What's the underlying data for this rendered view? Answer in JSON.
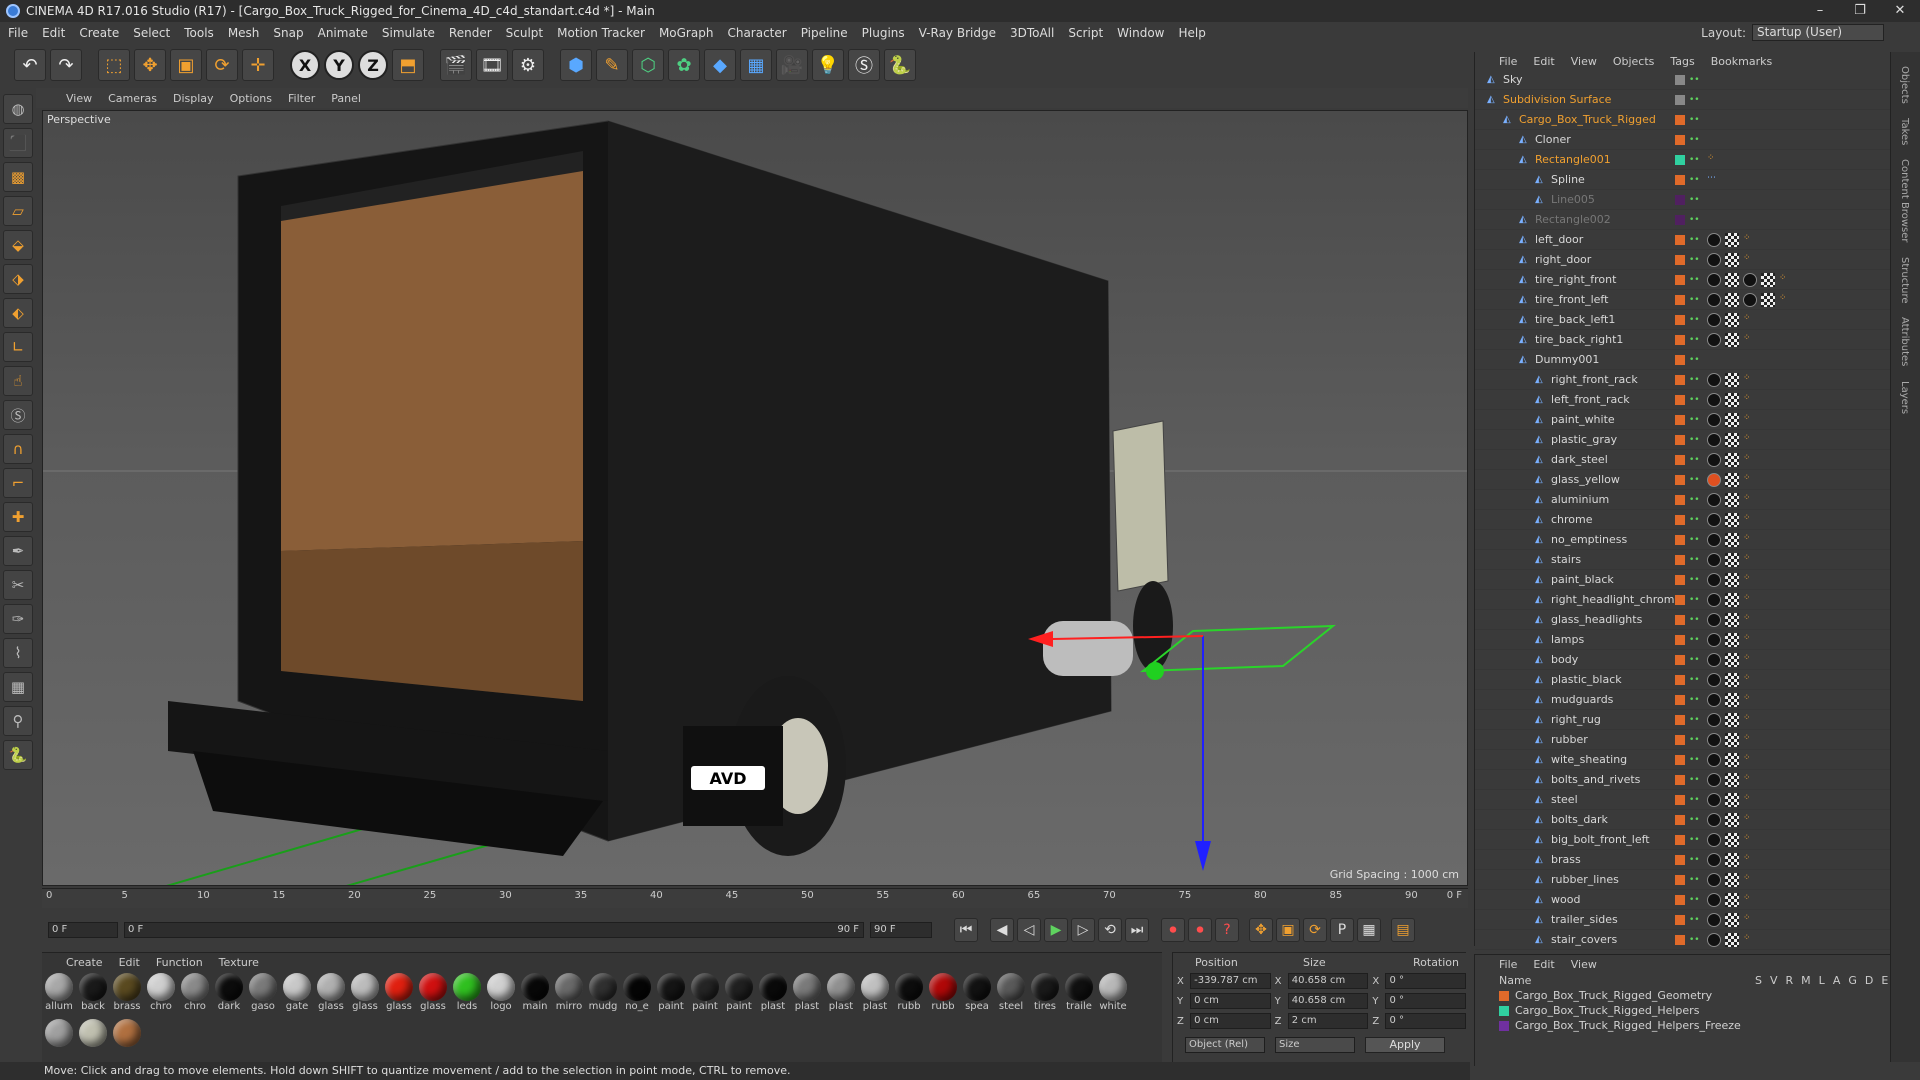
{
  "window": {
    "title": "CINEMA 4D R17.016 Studio (R17) - [Cargo_Box_Truck_Rigged_for_Cinema_4D_c4d_standart.c4d *] - Main"
  },
  "menu": [
    "File",
    "Edit",
    "Create",
    "Select",
    "Tools",
    "Mesh",
    "Snap",
    "Animate",
    "Simulate",
    "Render",
    "Sculpt",
    "Motion Tracker",
    "MoGraph",
    "Character",
    "Pipeline",
    "Plugins",
    "V-Ray Bridge",
    "3DToAll",
    "Script",
    "Window",
    "Help"
  ],
  "layout": {
    "label": "Layout:",
    "value": "Startup (User)"
  },
  "viewport": {
    "menu": [
      "View",
      "Cameras",
      "Display",
      "Options",
      "Filter",
      "Panel"
    ],
    "label": "Perspective",
    "grid_spacing": "Grid Spacing : 1000 cm",
    "plate": "AVD"
  },
  "timeline": {
    "ticks": [
      "0",
      "5",
      "10",
      "15",
      "20",
      "25",
      "30",
      "35",
      "40",
      "45",
      "50",
      "55",
      "60",
      "65",
      "70",
      "75",
      "80",
      "85",
      "90"
    ],
    "frame_end_label": "0 F",
    "start_field": "0 F",
    "slider_start": "0 F",
    "slider_end": "90 F",
    "end_field": "90 F"
  },
  "materials": {
    "menu": [
      "Create",
      "Edit",
      "Function",
      "Texture"
    ],
    "items": [
      {
        "n": "allum",
        "c": "#a8a8a8"
      },
      {
        "n": "back",
        "c": "#1a1a1a"
      },
      {
        "n": "brass",
        "c": "#5a4a20"
      },
      {
        "n": "chro",
        "c": "#cfcfcf"
      },
      {
        "n": "chro",
        "c": "#8a8a8a"
      },
      {
        "n": "dark",
        "c": "#0c0c0c"
      },
      {
        "n": "gaso",
        "c": "#7a7a7a"
      },
      {
        "n": "gate",
        "c": "#c8c8c8"
      },
      {
        "n": "glass",
        "c": "#b0b0b0"
      },
      {
        "n": "glass",
        "c": "#bcbcbc"
      },
      {
        "n": "glass",
        "c": "#e02010"
      },
      {
        "n": "glass",
        "c": "#d01010"
      },
      {
        "n": "leds",
        "c": "#30c020"
      },
      {
        "n": "logo",
        "c": "#d0d0d0"
      },
      {
        "n": "main",
        "c": "#080808"
      },
      {
        "n": "mirro",
        "c": "#6a6a6a"
      },
      {
        "n": "mudg",
        "c": "#303030"
      },
      {
        "n": "no_e",
        "c": "#050505"
      },
      {
        "n": "paint",
        "c": "#151515"
      },
      {
        "n": "paint",
        "c": "#252525"
      },
      {
        "n": "paint",
        "c": "#202020"
      },
      {
        "n": "plast",
        "c": "#0a0a0a"
      },
      {
        "n": "plast",
        "c": "#7a7a7a"
      },
      {
        "n": "plast",
        "c": "#909090"
      },
      {
        "n": "plast",
        "c": "#c0c0c0"
      },
      {
        "n": "rubb",
        "c": "#0d0d0d"
      },
      {
        "n": "rubb",
        "c": "#b00808"
      },
      {
        "n": "spea",
        "c": "#121212"
      },
      {
        "n": "steel",
        "c": "#5a5a5a"
      },
      {
        "n": "tires",
        "c": "#1a1a1a"
      },
      {
        "n": "traile",
        "c": "#101010"
      },
      {
        "n": "white",
        "c": "#b8b8b8"
      },
      {
        "n": "",
        "c": "#a0a0a0"
      },
      {
        "n": "",
        "c": "#c0c0b0"
      },
      {
        "n": "",
        "c": "#b07040"
      }
    ]
  },
  "coords": {
    "headers": [
      "Position",
      "Size",
      "Rotation"
    ],
    "rows": [
      {
        "a": "X",
        "pos": "-339.787 cm",
        "b": "X",
        "size": "40.658 cm",
        "c": "X",
        "rot": "0 °"
      },
      {
        "a": "Y",
        "pos": "0 cm",
        "b": "Y",
        "size": "40.658 cm",
        "c": "Y",
        "rot": "0 °"
      },
      {
        "a": "Z",
        "pos": "0 cm",
        "b": "Z",
        "size": "2 cm",
        "c": "Z",
        "rot": "0 °"
      }
    ],
    "mode": "Object (Rel)",
    "sizemode": "Size",
    "apply": "Apply"
  },
  "status": "Move: Click and drag to move elements. Hold down SHIFT to quantize movement / add to the selection in point mode, CTRL to remove.",
  "objects": {
    "menu": [
      "File",
      "Edit",
      "View",
      "Objects",
      "Tags",
      "Bookmarks"
    ],
    "items": [
      {
        "n": "Sky",
        "d": 0,
        "s": "n",
        "sw": "#888",
        "tags": ""
      },
      {
        "n": "Subdivision Surface",
        "d": 0,
        "s": "o",
        "sw": "#888",
        "tags": ""
      },
      {
        "n": "Cargo_Box_Truck_Rigged",
        "d": 1,
        "s": "o",
        "sw": "#e06a2a",
        "tags": ""
      },
      {
        "n": "Cloner",
        "d": 2,
        "s": "n",
        "sw": "#e06a2a",
        "tags": ""
      },
      {
        "n": "Rectangle001",
        "d": 2,
        "s": "o",
        "sw": "#30d0a0",
        "tags": "o"
      },
      {
        "n": "Spline",
        "d": 3,
        "s": "n",
        "sw": "#e06a2a",
        "tags": "s"
      },
      {
        "n": "Line005",
        "d": 3,
        "s": "d",
        "sw": "#502060",
        "tags": ""
      },
      {
        "n": "Rectangle002",
        "d": 2,
        "s": "d",
        "sw": "#502060",
        "tags": ""
      },
      {
        "n": "left_door",
        "d": 2,
        "s": "n",
        "sw": "#e06a2a",
        "tags": "bco"
      },
      {
        "n": "right_door",
        "d": 2,
        "s": "n",
        "sw": "#e06a2a",
        "tags": "bco"
      },
      {
        "n": "tire_right_front",
        "d": 2,
        "s": "n",
        "sw": "#e06a2a",
        "tags": "bcbco"
      },
      {
        "n": "tire_front_left",
        "d": 2,
        "s": "n",
        "sw": "#e06a2a",
        "tags": "bcbco"
      },
      {
        "n": "tire_back_left1",
        "d": 2,
        "s": "n",
        "sw": "#e06a2a",
        "tags": "bco"
      },
      {
        "n": "tire_back_right1",
        "d": 2,
        "s": "n",
        "sw": "#e06a2a",
        "tags": "bco"
      },
      {
        "n": "Dummy001",
        "d": 2,
        "s": "n",
        "sw": "#e06a2a",
        "tags": ""
      },
      {
        "n": "right_front_rack",
        "d": 3,
        "s": "n",
        "sw": "#e06a2a",
        "tags": "mco"
      },
      {
        "n": "left_front_rack",
        "d": 3,
        "s": "n",
        "sw": "#e06a2a",
        "tags": "mco"
      },
      {
        "n": "paint_white",
        "d": 3,
        "s": "n",
        "sw": "#e06a2a",
        "tags": "mco"
      },
      {
        "n": "plastic_gray",
        "d": 3,
        "s": "n",
        "sw": "#e06a2a",
        "tags": "mco"
      },
      {
        "n": "dark_steel",
        "d": 3,
        "s": "n",
        "sw": "#e06a2a",
        "tags": "mco"
      },
      {
        "n": "glass_yellow",
        "d": 3,
        "s": "n",
        "sw": "#e06a2a",
        "tags": "rco"
      },
      {
        "n": "aluminium",
        "d": 3,
        "s": "n",
        "sw": "#e06a2a",
        "tags": "mco"
      },
      {
        "n": "chrome",
        "d": 3,
        "s": "n",
        "sw": "#e06a2a",
        "tags": "mco"
      },
      {
        "n": "no_emptiness",
        "d": 3,
        "s": "n",
        "sw": "#e06a2a",
        "tags": "mco"
      },
      {
        "n": "stairs",
        "d": 3,
        "s": "n",
        "sw": "#e06a2a",
        "tags": "mco"
      },
      {
        "n": "paint_black",
        "d": 3,
        "s": "n",
        "sw": "#e06a2a",
        "tags": "mco"
      },
      {
        "n": "right_headlight_chrome",
        "d": 3,
        "s": "n",
        "sw": "#e06a2a",
        "tags": "mco"
      },
      {
        "n": "glass_headlights",
        "d": 3,
        "s": "n",
        "sw": "#e06a2a",
        "tags": "mco"
      },
      {
        "n": "lamps",
        "d": 3,
        "s": "n",
        "sw": "#e06a2a",
        "tags": "mco"
      },
      {
        "n": "body",
        "d": 3,
        "s": "n",
        "sw": "#e06a2a",
        "tags": "mco"
      },
      {
        "n": "plastic_black",
        "d": 3,
        "s": "n",
        "sw": "#e06a2a",
        "tags": "mco"
      },
      {
        "n": "mudguards",
        "d": 3,
        "s": "n",
        "sw": "#e06a2a",
        "tags": "mco"
      },
      {
        "n": "right_rug",
        "d": 3,
        "s": "n",
        "sw": "#e06a2a",
        "tags": "mco"
      },
      {
        "n": "rubber",
        "d": 3,
        "s": "n",
        "sw": "#e06a2a",
        "tags": "mco"
      },
      {
        "n": "wite_sheating",
        "d": 3,
        "s": "n",
        "sw": "#e06a2a",
        "tags": "mco"
      },
      {
        "n": "bolts_and_rivets",
        "d": 3,
        "s": "n",
        "sw": "#e06a2a",
        "tags": "mco"
      },
      {
        "n": "steel",
        "d": 3,
        "s": "n",
        "sw": "#e06a2a",
        "tags": "mco"
      },
      {
        "n": "bolts_dark",
        "d": 3,
        "s": "n",
        "sw": "#e06a2a",
        "tags": "mco"
      },
      {
        "n": "big_bolt_front_left",
        "d": 3,
        "s": "n",
        "sw": "#e06a2a",
        "tags": "mco"
      },
      {
        "n": "brass",
        "d": 3,
        "s": "n",
        "sw": "#e06a2a",
        "tags": "mco"
      },
      {
        "n": "rubber_lines",
        "d": 3,
        "s": "n",
        "sw": "#e06a2a",
        "tags": "mco"
      },
      {
        "n": "wood",
        "d": 3,
        "s": "n",
        "sw": "#e06a2a",
        "tags": "mco"
      },
      {
        "n": "trailer_sides",
        "d": 3,
        "s": "n",
        "sw": "#e06a2a",
        "tags": "mco"
      },
      {
        "n": "stair_covers",
        "d": 3,
        "s": "n",
        "sw": "#e06a2a",
        "tags": "mco"
      }
    ]
  },
  "layers": {
    "menu": [
      "File",
      "Edit",
      "View"
    ],
    "header": {
      "name": "Name",
      "cols": [
        "S",
        "V",
        "R",
        "M",
        "L",
        "A",
        "G",
        "D",
        "E"
      ]
    },
    "items": [
      {
        "n": "Cargo_Box_Truck_Rigged_Geometry",
        "c": "#e06a2a"
      },
      {
        "n": "Cargo_Box_Truck_Rigged_Helpers",
        "c": "#30d0a0"
      },
      {
        "n": "Cargo_Box_Truck_Rigged_Helpers_Freeze",
        "c": "#7030a0"
      }
    ]
  },
  "right_tabs": [
    "Objects",
    "Takes",
    "Content Browser",
    "Structure",
    "Attributes",
    "Layers"
  ]
}
